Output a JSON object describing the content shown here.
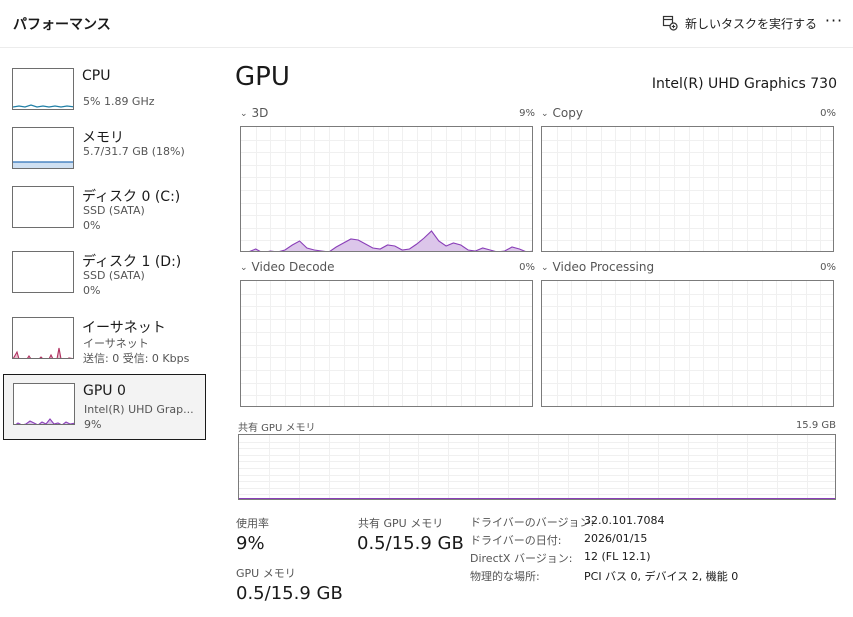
{
  "header": {
    "title": "パフォーマンス",
    "run_task_label": "新しいタスクを実行する",
    "run_task_icon": "run-task-icon",
    "more_label": "···"
  },
  "sidebar": {
    "items": [
      {
        "name": "CPU",
        "lines": [
          "5%  1.89 GHz"
        ],
        "color": "#1f7fa6"
      },
      {
        "name": "メモリ",
        "lines": [
          "5.7/31.7 GB (18%)"
        ],
        "color": "#2f72b8"
      },
      {
        "name": "ディスク 0 (C:)",
        "lines": [
          "SSD (SATA)",
          "0%"
        ],
        "color": "#3a8a3a"
      },
      {
        "name": "ディスク 1 (D:)",
        "lines": [
          "SSD (SATA)",
          "0%"
        ],
        "color": "#3a8a3a"
      },
      {
        "name": "イーサネット",
        "lines": [
          "イーサネット",
          "送信: 0 受信: 0 Kbps"
        ],
        "color": "#b03060"
      },
      {
        "name": "GPU 0",
        "lines": [
          "Intel(R) UHD Grap...",
          "9%"
        ],
        "color": "#8a3fb8"
      }
    ]
  },
  "main": {
    "title": "GPU",
    "device": "Intel(R) UHD Graphics 730",
    "graphs": [
      {
        "label": "3D",
        "value": "9%"
      },
      {
        "label": "Copy",
        "value": "0%"
      },
      {
        "label": "Video Decode",
        "value": "0%"
      },
      {
        "label": "Video Processing",
        "value": "0%"
      }
    ],
    "shared_memory_graph": {
      "label": "共有 GPU メモリ",
      "max": "15.9 GB"
    },
    "stats": {
      "usage_label": "使用率",
      "usage_value": "9%",
      "shared_label": "共有 GPU メモリ",
      "shared_value": "0.5/15.9 GB",
      "gpu_mem_label": "GPU メモリ",
      "gpu_mem_value": "0.5/15.9 GB"
    },
    "info": [
      {
        "key": "ドライバーのバージョン:",
        "value": "32.0.101.7084"
      },
      {
        "key": "ドライバーの日付:",
        "value": "2026/01/15"
      },
      {
        "key": "DirectX バージョン:",
        "value": "12 (FL 12.1)"
      },
      {
        "key": "物理的な場所:",
        "value": "PCI バス 0, デバイス 2, 機能 0"
      }
    ]
  },
  "accent": "#8a3fb8"
}
